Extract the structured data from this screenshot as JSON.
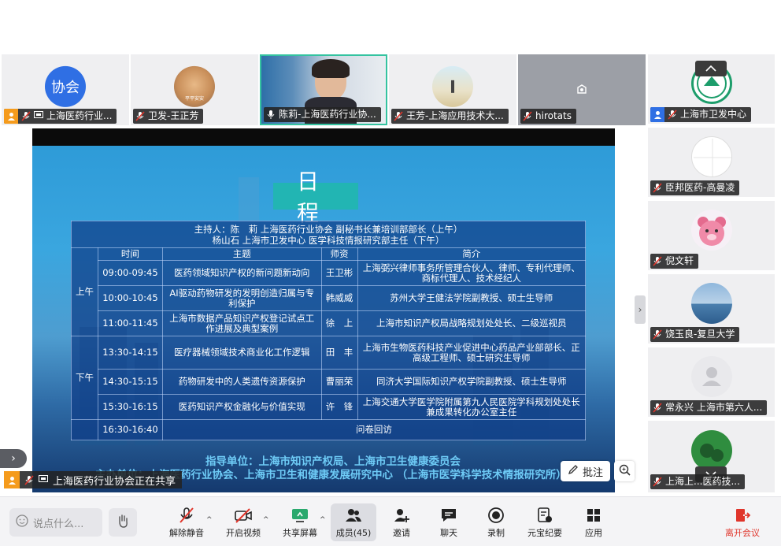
{
  "participants_top": [
    {
      "name": "上海医药行业...",
      "avatar_text": "协会",
      "avatar_color": "#2f6fe4",
      "host": true
    },
    {
      "name": "卫发-王正芳",
      "avatar_text": "平平安安"
    },
    {
      "name": "陈莉-上海医药行业协...",
      "video": true
    },
    {
      "name": "王芳-上海应用技术大..."
    },
    {
      "name": "hirotats"
    }
  ],
  "participants_right": [
    {
      "name": "上海市卫发中心",
      "cohost": true
    },
    {
      "name": "臣邦医药-高曼凌"
    },
    {
      "name": "倪文轩"
    },
    {
      "name": "饶玉良-复旦大学"
    },
    {
      "name": "常永兴 上海市第六人..."
    },
    {
      "name": "上海上...医药技..."
    }
  ],
  "slide": {
    "title": "日程",
    "hosts_line1": "主持人：陈　莉 上海医药行业协会 副秘书长兼培训部部长（上午）",
    "hosts_line2": "杨山石 上海市卫发中心 医学科技情报研究部主任（下午）",
    "headers": {
      "time": "时间",
      "topic": "主题",
      "speaker": "师资",
      "intro": "简介"
    },
    "am_label": "上午",
    "pm_label": "下午",
    "rows": [
      {
        "time": "09:00-09:45",
        "topic": "医药领域知识产权的新问题新动向",
        "speaker": "王卫彬",
        "intro": "上海弼兴律师事务所管理合伙人、律师、专利代理师、商标代理人、技术经纪人"
      },
      {
        "time": "10:00-10:45",
        "topic": "AI驱动药物研发的发明创造归属与专利保护",
        "speaker": "韩威威",
        "intro": "苏州大学王健法学院副教授、硕士生导师"
      },
      {
        "time": "11:00-11:45",
        "topic": "上海市数据产品知识产权登记试点工作进展及典型案例",
        "speaker": "徐　上",
        "intro": "上海市知识产权局战略规划处处长、二级巡视员"
      },
      {
        "time": "13:30-14:15",
        "topic": "医疗器械领域技术商业化工作逻辑",
        "speaker": "田　丰",
        "intro": "上海市生物医药科技产业促进中心药品产业部部长、正高级工程师、硕士研究生导师"
      },
      {
        "time": "14:30-15:15",
        "topic": "药物研发中的人类遗传资源保护",
        "speaker": "曹丽荣",
        "intro": "同济大学国际知识产权学院副教授、硕士生导师"
      },
      {
        "time": "15:30-16:15",
        "topic": "医药知识产权金融化与价值实现",
        "speaker": "许　锋",
        "intro": "上海交通大学医学院附属第九人民医院学科规划处处长兼成果转化办公室主任"
      },
      {
        "time": "16:30-16:40",
        "topic": "问卷回访",
        "speaker": "",
        "intro": ""
      }
    ],
    "footer_guide": "指导单位：上海市知识产权局、上海市卫生健康委员会",
    "footer_host": "主办单位：上海医药行业协会、上海市卫生和健康发展研究中心 （上海市医学科学技术情报研究所）"
  },
  "sharing_banner": "上海医药行业协会正在共享",
  "annotate_label": "批注",
  "toolbar": {
    "chat_placeholder": "说点什么...",
    "buttons": [
      {
        "label": "解除静音",
        "icon": "mic-off-icon"
      },
      {
        "label": "开启视频",
        "icon": "video-off-icon"
      },
      {
        "label": "共享屏幕",
        "icon": "share-screen-icon"
      },
      {
        "label": "成员(45)",
        "icon": "members-icon"
      },
      {
        "label": "邀请",
        "icon": "invite-icon"
      },
      {
        "label": "聊天",
        "icon": "chat-icon"
      },
      {
        "label": "录制",
        "icon": "record-icon"
      },
      {
        "label": "元宝纪要",
        "icon": "notes-icon"
      },
      {
        "label": "应用",
        "icon": "apps-icon"
      },
      {
        "label": "离开会议",
        "icon": "leave-icon"
      }
    ]
  },
  "colors": {
    "accent": "#2f6fe4",
    "danger": "#e0352b",
    "host": "#f59b1c"
  }
}
